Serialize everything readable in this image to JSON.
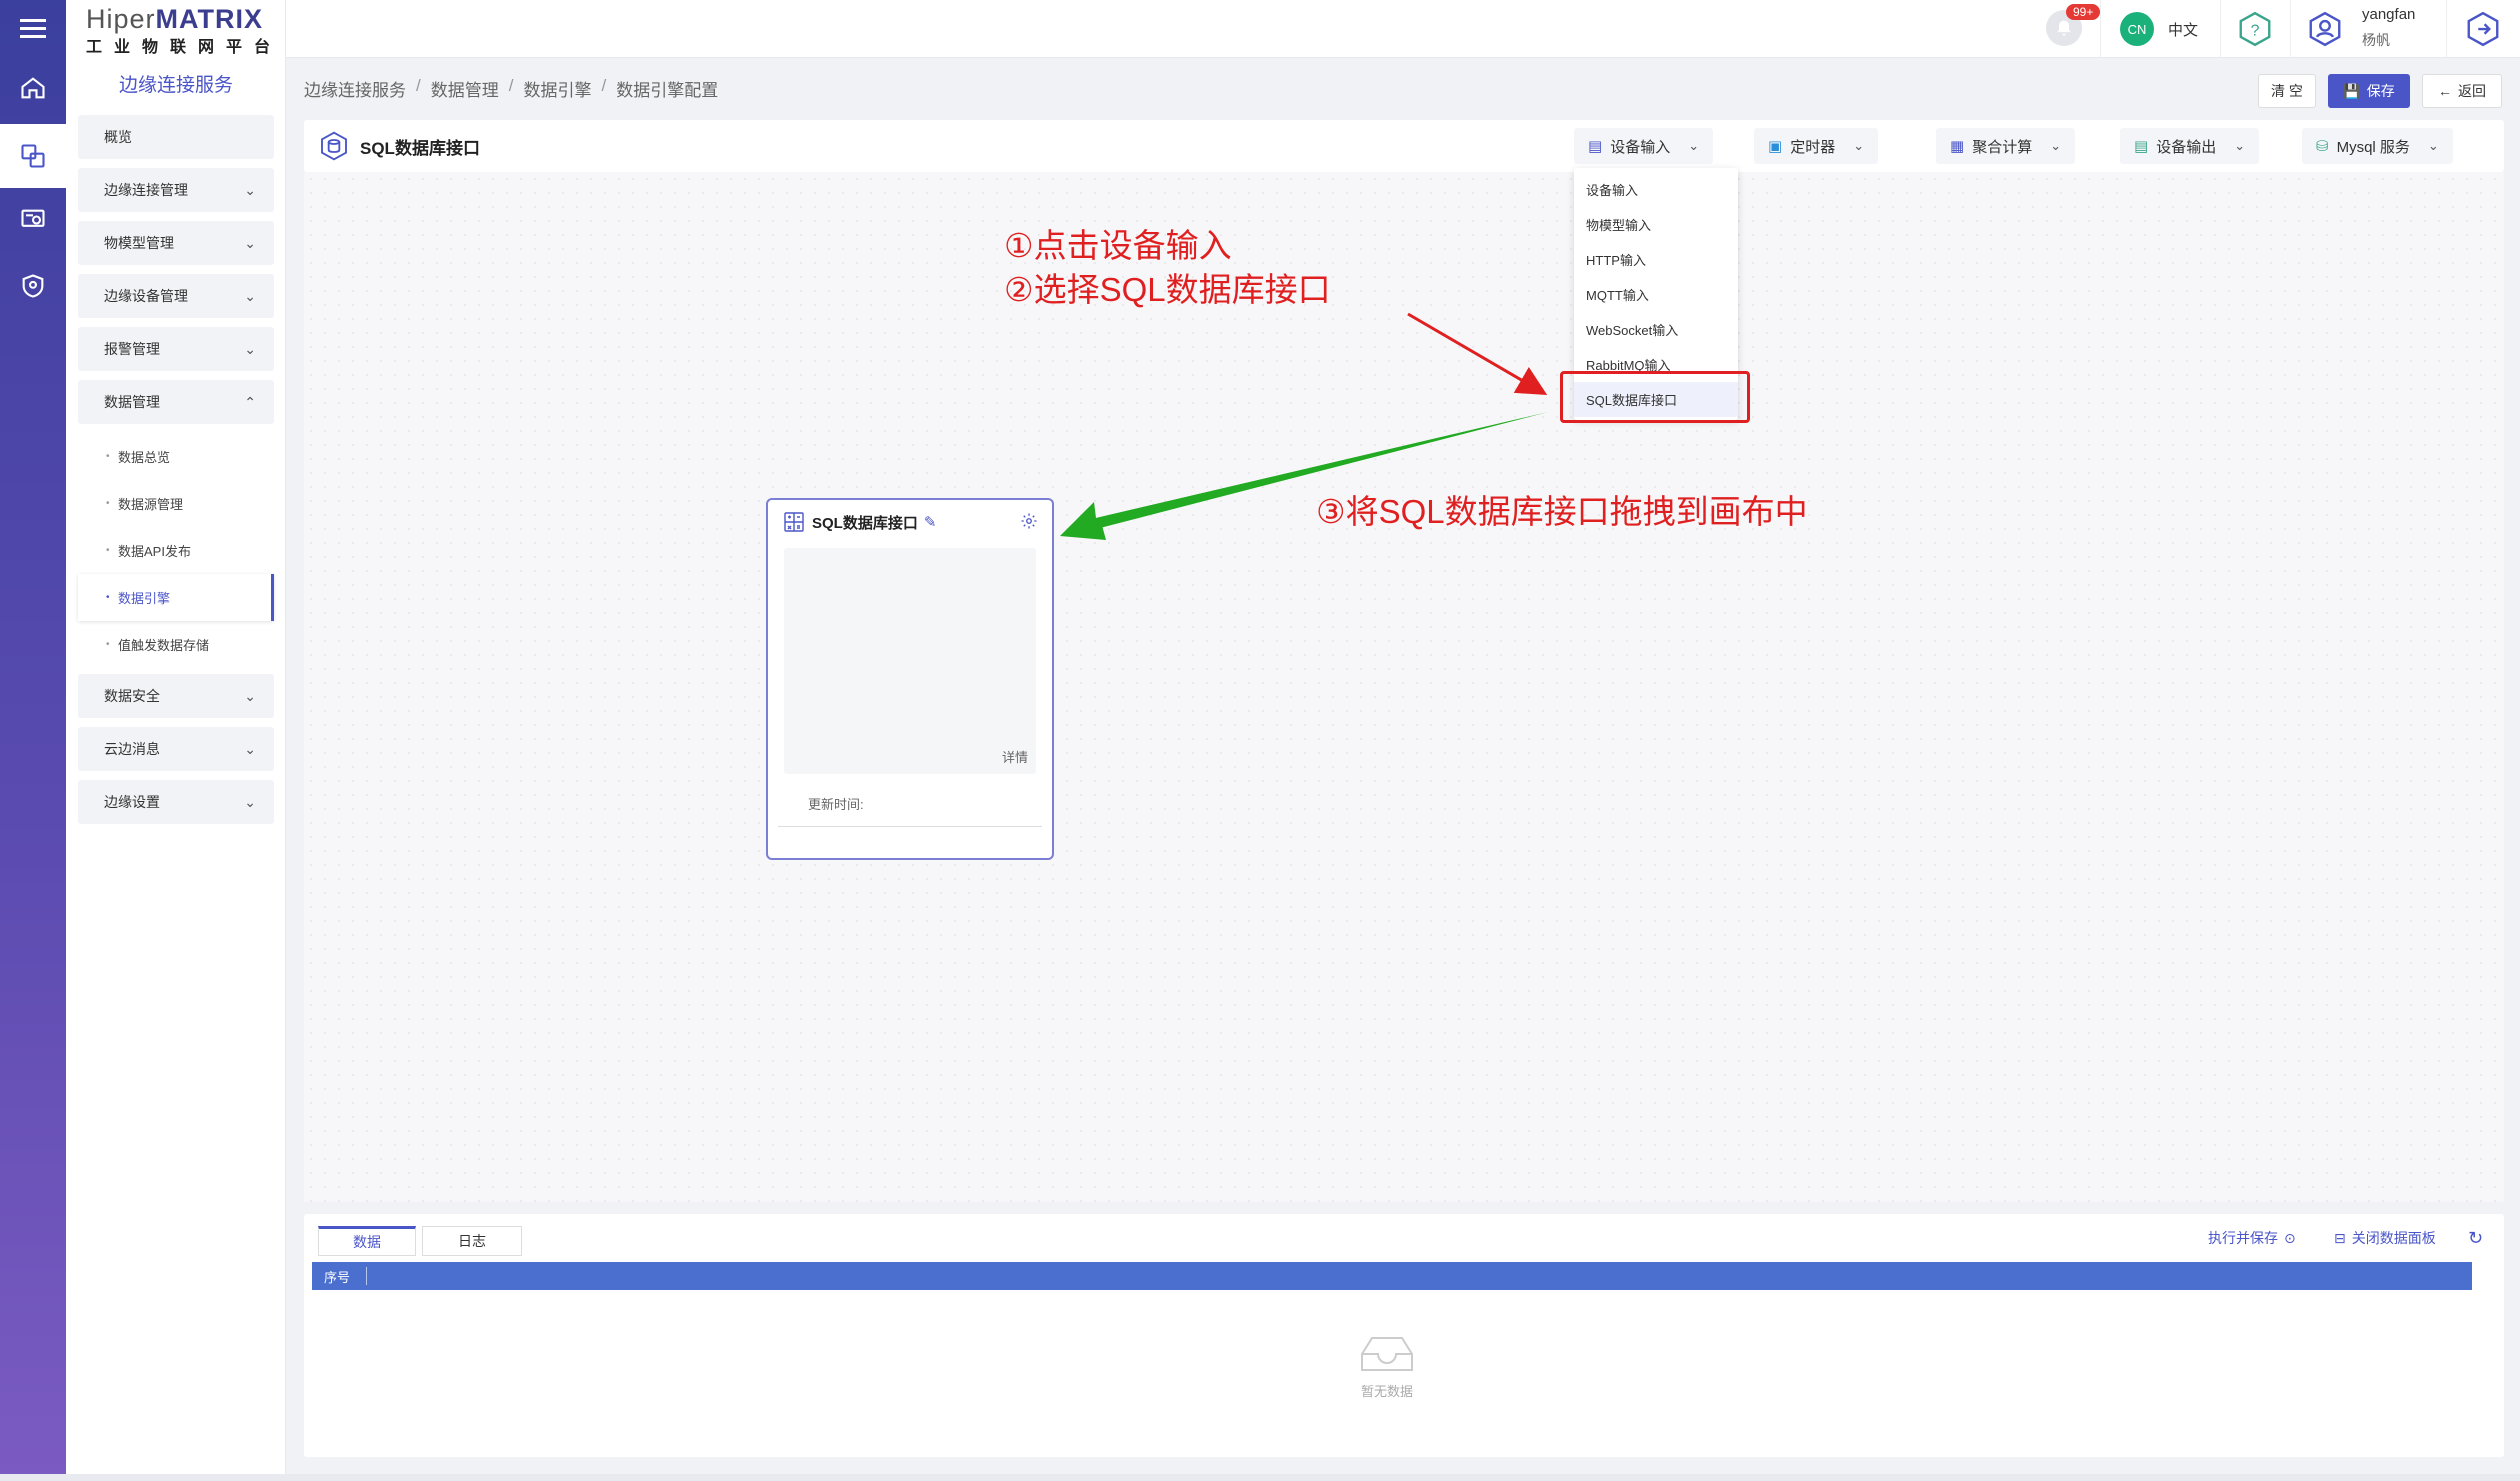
{
  "brand": {
    "name_thin": "Hiper",
    "name_bold": "MATRIX",
    "subtitle": "工业物联网平台"
  },
  "sidebar": {
    "title": "边缘连接服务",
    "items": [
      {
        "label": "概览"
      },
      {
        "label": "边缘连接管理"
      },
      {
        "label": "物模型管理"
      },
      {
        "label": "边缘设备管理"
      },
      {
        "label": "报警管理"
      },
      {
        "label": "数据管理"
      }
    ],
    "sub_items": [
      {
        "label": "数据总览"
      },
      {
        "label": "数据源管理"
      },
      {
        "label": "数据API发布"
      },
      {
        "label": "数据引擎"
      },
      {
        "label": "值触发数据存储"
      }
    ],
    "items_after": [
      {
        "label": "数据安全"
      },
      {
        "label": "云边消息"
      },
      {
        "label": "边缘设置"
      }
    ]
  },
  "header": {
    "badge": "99+",
    "lang_code": "CN",
    "lang_label": "中文",
    "user_name": "yangfan",
    "user_cn": "杨帆"
  },
  "breadcrumb": [
    "边缘连接服务",
    "数据管理",
    "数据引擎",
    "数据引擎配置"
  ],
  "actions": {
    "clear": "清 空",
    "save": "保存",
    "back": "返回"
  },
  "toolbar": {
    "title": "SQL数据库接口",
    "buttons": [
      "设备输入",
      "定时器",
      "聚合计算",
      "设备输出",
      "Mysql 服务"
    ]
  },
  "dropdown": {
    "items": [
      "设备输入",
      "物模型输入",
      "HTTP输入",
      "MQTT输入",
      "WebSocket输入",
      "RabbitMQ输入",
      "SQL数据库接口"
    ]
  },
  "annotations": {
    "step1": "①点击设备输入",
    "step2": "②选择SQL数据库接口",
    "step3": "③将SQL数据库接口拖拽到画布中"
  },
  "node": {
    "title": "SQL数据库接口",
    "detail": "详情",
    "time_label": "更新时间:"
  },
  "bottom_panel": {
    "tabs": [
      "数据",
      "日志"
    ],
    "execute_save": "执行并保存",
    "close_panel": "关闭数据面板",
    "column": "序号",
    "empty": "暂无数据"
  },
  "colors": {
    "accent": "#4a55c8",
    "annotation": "#e02020",
    "arrow_green": "#22aa22",
    "table_header": "#4a6fcf"
  }
}
